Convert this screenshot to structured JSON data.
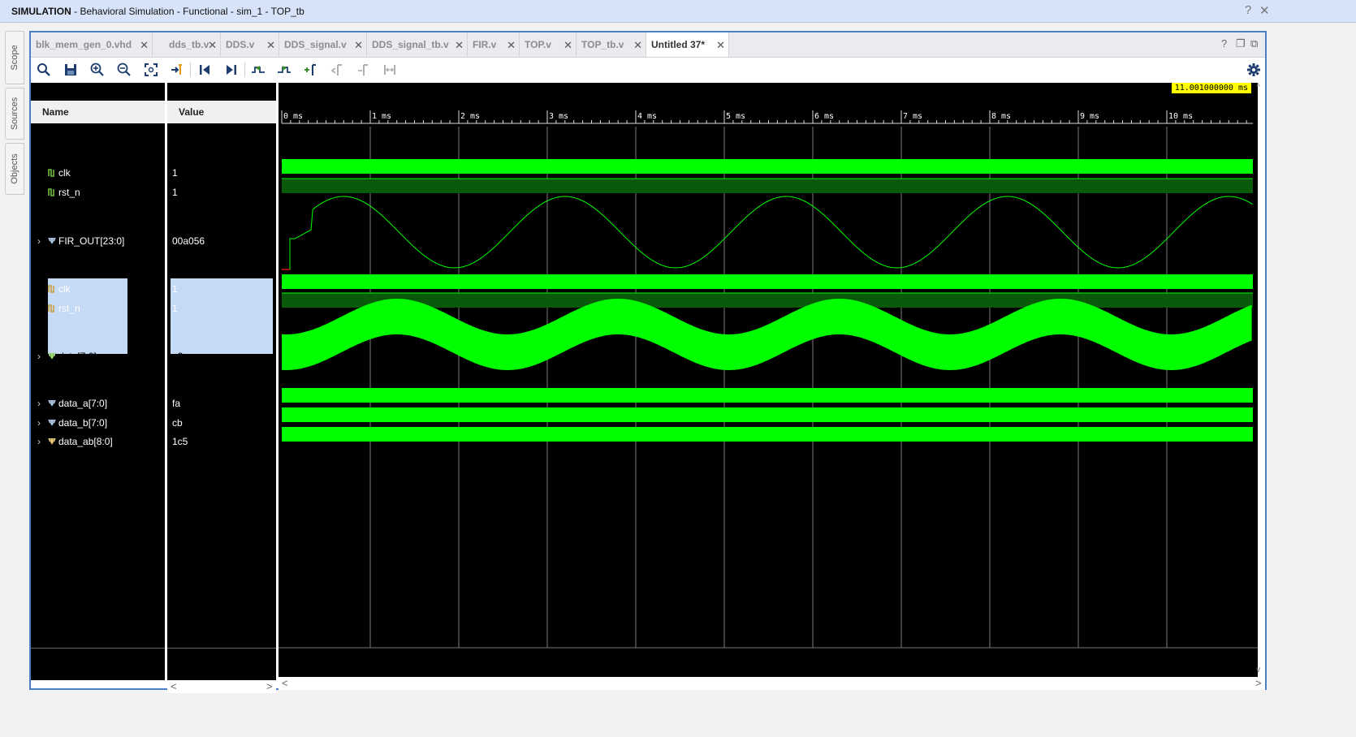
{
  "window": {
    "title_bold": "SIMULATION",
    "title_rest": " - Behavioral Simulation - Functional - sim_1 - TOP_tb",
    "help": "?",
    "close": "✕"
  },
  "side_tabs": [
    "Scope",
    "Sources",
    "Objects"
  ],
  "tabs": [
    {
      "label": "blk_mem_gen_0.vhd",
      "active": false
    },
    {
      "label": "dds_tb.v",
      "active": false
    },
    {
      "label": "DDS.v",
      "active": false
    },
    {
      "label": "DDS_signal.v",
      "active": false
    },
    {
      "label": "DDS_signal_tb.v",
      "active": false
    },
    {
      "label": "FIR.v",
      "active": false
    },
    {
      "label": "TOP.v",
      "active": false
    },
    {
      "label": "TOP_tb.v",
      "active": false
    },
    {
      "label": "Untitled 37*",
      "active": true
    }
  ],
  "tab_close": "✕",
  "panel_controls": {
    "help": "?",
    "restore": "❐",
    "maximize": "⧉"
  },
  "toolbar_icons": [
    "search-icon",
    "save-icon",
    "zoom-in-icon",
    "zoom-out-icon",
    "zoom-fit-icon",
    "go-to-cursor-icon",
    "go-to-time-zero-icon",
    "go-to-last-time-icon",
    "previous-transition-icon",
    "next-transition-icon",
    "add-marker-icon",
    "previous-marker-icon",
    "next-marker-icon",
    "swap-cursors-icon"
  ],
  "columns": {
    "name": "Name",
    "value": "Value"
  },
  "signals": [
    {
      "name": "clk",
      "value": "1",
      "type": "bit",
      "expandable": false,
      "icon_color": "#6fbf3c"
    },
    {
      "name": "rst_n",
      "value": "1",
      "type": "bit",
      "expandable": false,
      "icon_color": "#6fbf3c"
    },
    {
      "name": "FIR_OUT[23:0]",
      "value": "00a056",
      "type": "analog",
      "expandable": true,
      "icon_color": "#7aa0c8"
    },
    {
      "name": "clk",
      "value": "1",
      "type": "bit",
      "expandable": false,
      "icon_color": "#c8a03c"
    },
    {
      "name": "rst_n",
      "value": "1",
      "type": "bit",
      "expandable": false,
      "icon_color": "#c8a03c"
    },
    {
      "name": "data[7:0]",
      "value": "e2",
      "type": "analog-band",
      "expandable": true,
      "selected": true,
      "icon_color": "#6fbf3c"
    },
    {
      "name": "data_a[7:0]",
      "value": "fa",
      "type": "bus",
      "expandable": true,
      "icon_color": "#7aa0c8"
    },
    {
      "name": "data_b[7:0]",
      "value": "cb",
      "type": "bus",
      "expandable": true,
      "icon_color": "#7aa0c8"
    },
    {
      "name": "data_ab[8:0]",
      "value": "1c5",
      "type": "bus",
      "expandable": true,
      "icon_color": "#c8a03c"
    }
  ],
  "timeline": {
    "cursor_label": "11.001000000 ms",
    "ticks": [
      "0 ms",
      "1 ms",
      "2 ms",
      "3 ms",
      "4 ms",
      "5 ms",
      "6 ms",
      "7 ms",
      "8 ms",
      "9 ms",
      "10 ms"
    ],
    "range_ms": [
      0,
      11
    ]
  },
  "waveforms": {
    "fir_out_period_ms": 2.5,
    "data_period_ms": 2.5,
    "colors": {
      "wave": "#00ff00",
      "dim": "#0b5a0b",
      "grid": "#7a7a7a",
      "reset_glitch": "#ff2020"
    }
  },
  "scroll": {
    "left": "<",
    "right": ">",
    "up": "^",
    "down": "v"
  }
}
